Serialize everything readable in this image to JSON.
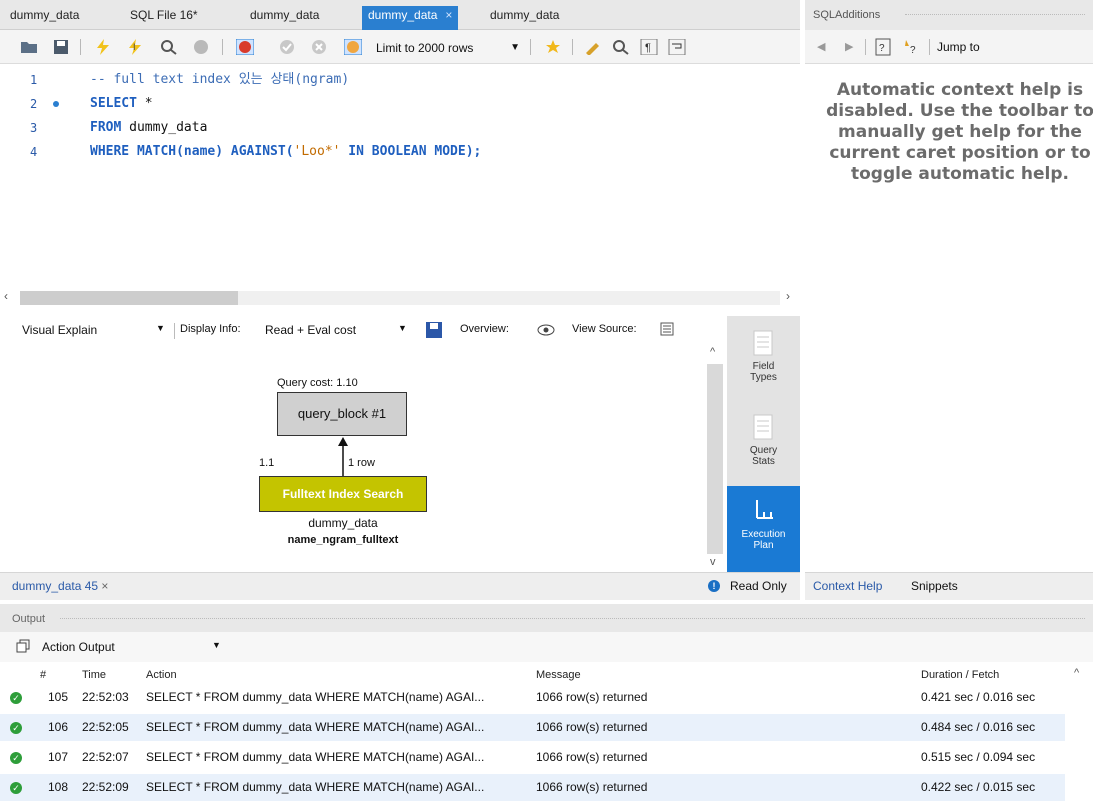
{
  "tabs": [
    {
      "label": "dummy_data"
    },
    {
      "label": "SQL File 16*"
    },
    {
      "label": "dummy_data"
    },
    {
      "label": "dummy_data",
      "active": true,
      "close": "×"
    },
    {
      "label": "dummy_data"
    }
  ],
  "toolbar": {
    "limit": "Limit to 2000 rows",
    "icons": [
      "open-folder-icon",
      "save-icon",
      "execute-icon",
      "execute-current-icon",
      "explain-icon",
      "stop-icon",
      "toggle-continue-icon",
      "commit-icon",
      "rollback-icon",
      "autocommit-icon",
      "favorite-icon",
      "beautify-icon",
      "find-icon",
      "invisible-chars-icon",
      "wrap-icon"
    ]
  },
  "editor": {
    "lines": [
      {
        "num": "1",
        "comment": "-- full text index 있는 상태(ngram)"
      },
      {
        "num": "2",
        "kw": "SELECT",
        "rest": " *"
      },
      {
        "num": "3",
        "kw": "FROM",
        "rest": " dummy_data"
      },
      {
        "num": "4",
        "kw": "WHERE MATCH",
        "rest": "(name) ",
        "kw2": "AGAINST",
        "rest2": "(",
        "str": "'Loo*'",
        "kw3": " IN BOOLEAN MODE",
        "rest3": ");"
      }
    ]
  },
  "visual_explain": {
    "mode": "Visual Explain",
    "display_info_label": "Display Info:",
    "display_info_value": "Read + Eval cost",
    "overview_label": "Overview:",
    "view_source_label": "View Source:",
    "query_cost": "Query cost: 1.10",
    "query_block": "query_block #1",
    "edge_cost": "1.1",
    "edge_rows": "1 row",
    "op": "Fulltext Index Search",
    "table": "dummy_data",
    "index": "name_ngram_fulltext"
  },
  "side_tools": [
    {
      "label1": "Field",
      "label2": "Types"
    },
    {
      "label1": "Query",
      "label2": "Stats"
    },
    {
      "label1": "Execution",
      "label2": "Plan",
      "active": true
    }
  ],
  "result_tab": {
    "label": "dummy_data 45",
    "close": "×",
    "status": "Read Only"
  },
  "sql_additions": {
    "title": "SQLAdditions",
    "jump_to": "Jump to",
    "help_text": "Automatic context help is disabled. Use the toolbar to manually get help for the current caret position or to toggle automatic help.",
    "tabs": [
      "Context Help",
      "Snippets"
    ]
  },
  "output": {
    "title": "Output",
    "selector": "Action Output",
    "columns": [
      "#",
      "Time",
      "Action",
      "Message",
      "Duration / Fetch"
    ],
    "rows": [
      {
        "num": "105",
        "time": "22:52:03",
        "action": "SELECT * FROM dummy_data WHERE MATCH(name) AGAI...",
        "message": "1066 row(s) returned",
        "duration": "0.421 sec / 0.016 sec"
      },
      {
        "num": "106",
        "time": "22:52:05",
        "action": "SELECT * FROM dummy_data WHERE MATCH(name) AGAI...",
        "message": "1066 row(s) returned",
        "duration": "0.484 sec / 0.016 sec"
      },
      {
        "num": "107",
        "time": "22:52:07",
        "action": "SELECT * FROM dummy_data WHERE MATCH(name) AGAI...",
        "message": "1066 row(s) returned",
        "duration": "0.515 sec / 0.094 sec"
      },
      {
        "num": "108",
        "time": "22:52:09",
        "action": "SELECT * FROM dummy_data WHERE MATCH(name) AGAI...",
        "message": "1066 row(s) returned",
        "duration": "0.422 sec / 0.015 sec"
      }
    ]
  },
  "colors": {
    "accent": "#1a7ad4",
    "op_box": "#c4c400",
    "ok": "#2e9e3a"
  }
}
